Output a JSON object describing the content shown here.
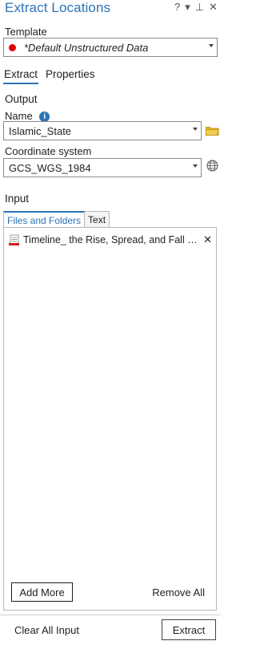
{
  "window": {
    "title": "Extract Locations"
  },
  "template": {
    "label": "Template",
    "value": "*Default Unstructured Data"
  },
  "tabs": [
    "Extract",
    "Properties"
  ],
  "output": {
    "section_label": "Output",
    "name_label": "Name",
    "name_value": "Islamic_State",
    "coord_label": "Coordinate system",
    "coord_value": "GCS_WGS_1984"
  },
  "input": {
    "section_label": "Input",
    "subtabs": [
      "Files and Folders",
      "Text"
    ],
    "items": [
      {
        "label": "Timeline_ the Rise, Spread, and Fall of the Islamic State"
      }
    ],
    "add_more_label": "Add More",
    "remove_all_label": "Remove All"
  },
  "footer": {
    "clear_label": "Clear All Input",
    "extract_label": "Extract"
  },
  "colors": {
    "accent": "#2b73b6",
    "template_dot": "#e00000",
    "folder": "#e8b62a"
  }
}
